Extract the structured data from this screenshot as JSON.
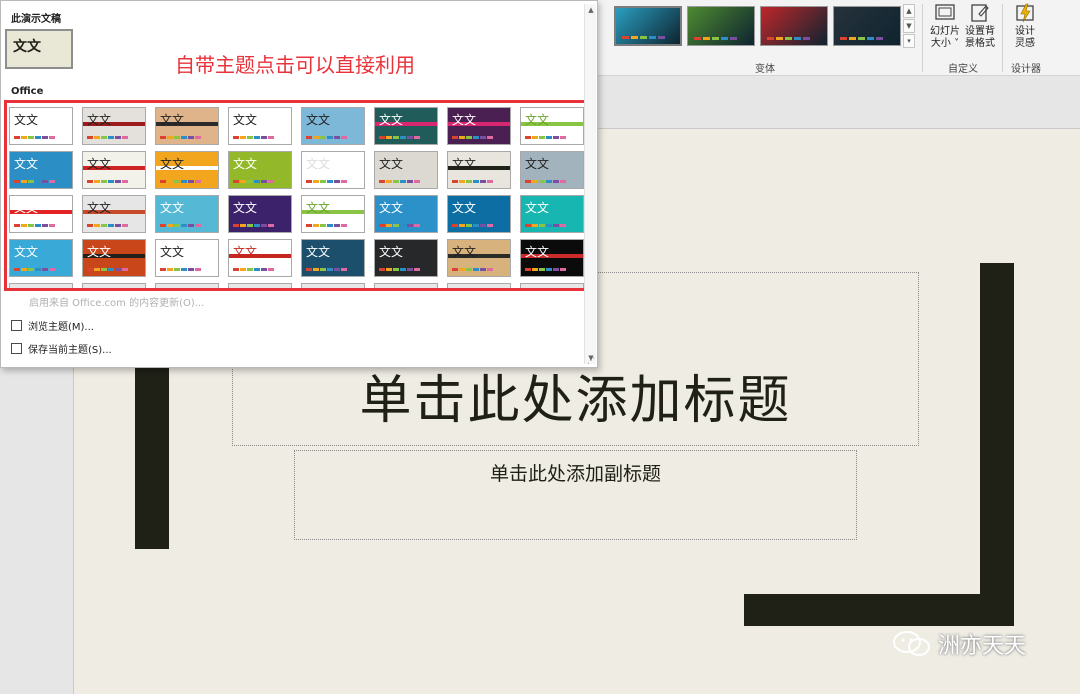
{
  "ribbon": {
    "variants_group_label": "变体",
    "variants": [
      {
        "name": "teal",
        "bg": "#2a9ec0"
      },
      {
        "name": "green",
        "bg": "#4d8a30"
      },
      {
        "name": "red",
        "bg": "#c0262a"
      },
      {
        "name": "dark",
        "bg": "#27323b"
      }
    ],
    "customize_group_label": "自定义",
    "slide_size_label_1": "幻灯片",
    "slide_size_label_2": "大小 ˅",
    "format_bg_label_1": "设置背",
    "format_bg_label_2": "景格式",
    "designer_group_label": "设计器",
    "design_ideas_label_1": "设计",
    "design_ideas_label_2": "灵感"
  },
  "panel": {
    "current_section": "此演示文稿",
    "office_section": "Office",
    "sample_text": "文文",
    "annotation": "自带主题点击可以直接利用",
    "office_online_item": "启用来自 Office.com 的内容更新(O)...",
    "browse_item": "浏览主题(M)...",
    "save_item": "保存当前主题(S)...",
    "themes": [
      {
        "bg": "#ffffff",
        "fg": "#222222",
        "accent": ""
      },
      {
        "bg": "#e4e1dc",
        "fg": "#222222",
        "accent": "#9b1c1c"
      },
      {
        "bg": "#e0b48a",
        "fg": "#222222",
        "accent": "#2b2b2b"
      },
      {
        "bg": "#ffffff",
        "fg": "#222222",
        "accent": ""
      },
      {
        "bg": "#7db8d8",
        "fg": "#222222",
        "accent": ""
      },
      {
        "bg": "#1f5c5a",
        "fg": "#ffffff",
        "accent": "#d72770"
      },
      {
        "bg": "#4a1f52",
        "fg": "#ffffff",
        "accent": "#d72770"
      },
      {
        "bg": "#ffffff",
        "fg": "#6aa42a",
        "accent": "#8ac444"
      },
      {
        "bg": "#2b8ec4",
        "fg": "#ffffff",
        "accent": ""
      },
      {
        "bg": "#f2f2ea",
        "fg": "#222222",
        "accent": "#d02424"
      },
      {
        "bg": "#f2a61d",
        "fg": "#222222",
        "accent": "#ffffff"
      },
      {
        "bg": "#93b92b",
        "fg": "#ffffff",
        "accent": ""
      },
      {
        "bg": "#ffffff",
        "fg": "#dddddd",
        "accent": ""
      },
      {
        "bg": "#dcd8d2",
        "fg": "#222222",
        "accent": ""
      },
      {
        "bg": "#e7e5dd",
        "fg": "#222222",
        "accent": "#1f2016"
      },
      {
        "bg": "#a2b3bd",
        "fg": "#222222",
        "accent": ""
      },
      {
        "bg": "#ffffff",
        "fg": "#ffffff",
        "accent": "#e32323"
      },
      {
        "bg": "#e6e6e6",
        "fg": "#222222",
        "accent": "#c54b2a"
      },
      {
        "bg": "#55b9d6",
        "fg": "#ffffff",
        "accent": ""
      },
      {
        "bg": "#3c226b",
        "fg": "#ffffff",
        "accent": ""
      },
      {
        "bg": "#ffffff",
        "fg": "#6aa42a",
        "accent": "#8ac444"
      },
      {
        "bg": "#2c91c8",
        "fg": "#ffffff",
        "accent": ""
      },
      {
        "bg": "#0d6ea3",
        "fg": "#ffffff",
        "accent": ""
      },
      {
        "bg": "#18b6b0",
        "fg": "#ffffff",
        "accent": ""
      },
      {
        "bg": "#39a9d8",
        "fg": "#ffffff",
        "accent": ""
      },
      {
        "bg": "#c8461a",
        "fg": "#ffffff",
        "accent": "#231f1c"
      },
      {
        "bg": "#ffffff",
        "fg": "#222222",
        "accent": ""
      },
      {
        "bg": "#ffffff",
        "fg": "#c6261f",
        "accent": "#c6261f"
      },
      {
        "bg": "#1b4f6b",
        "fg": "#ffffff",
        "accent": ""
      },
      {
        "bg": "#26282a",
        "fg": "#ffffff",
        "accent": ""
      },
      {
        "bg": "#d8b27c",
        "fg": "#222222",
        "accent": "#2b2b2b"
      },
      {
        "bg": "#0b0b0b",
        "fg": "#ffffff",
        "accent": "#cc2a2a"
      }
    ]
  },
  "slide": {
    "title": "单击此处添加标题",
    "subtitle": "单击此处添加副标题"
  },
  "watermark": "洲亦天天",
  "colors": {
    "bar_palette": [
      "#d9432f",
      "#f2a61d",
      "#8ac444",
      "#2b8ec4",
      "#7a4ea0",
      "#e06aa0"
    ]
  }
}
